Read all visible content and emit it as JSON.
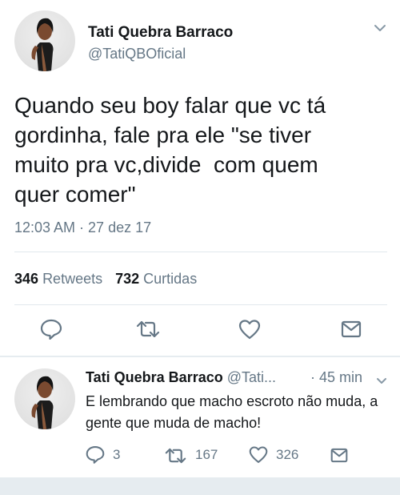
{
  "main_tweet": {
    "author_name": "Tati Quebra Barraco",
    "author_handle": "@TatiQBOficial",
    "text": "Quando seu boy falar que vc tá\ngordinha, fale pra ele \"se tiver\nmuito pra vc,divide  com quem\nquer comer\"",
    "timestamp": "12:03 AM · 27 dez 17",
    "retweets_count": "346",
    "retweets_label": "Retweets",
    "likes_count": "732",
    "likes_label": "Curtidas",
    "icons": [
      "reply-icon",
      "retweet-icon",
      "like-icon",
      "share-icon",
      "chevron-down-icon"
    ]
  },
  "reply_tweet": {
    "author_name": "Tati Quebra Barraco",
    "author_handle": "@Tati...",
    "time": "· 45 min",
    "text": "E lembrando que macho escroto não muda, a gente que muda de macho!",
    "reply_count": "3",
    "retweet_count": "167",
    "like_count": "326"
  },
  "colors": {
    "primary_text": "#14171a",
    "secondary_text": "#657786",
    "divider": "#e1e8ed",
    "background_gray": "#e6ecf0"
  }
}
